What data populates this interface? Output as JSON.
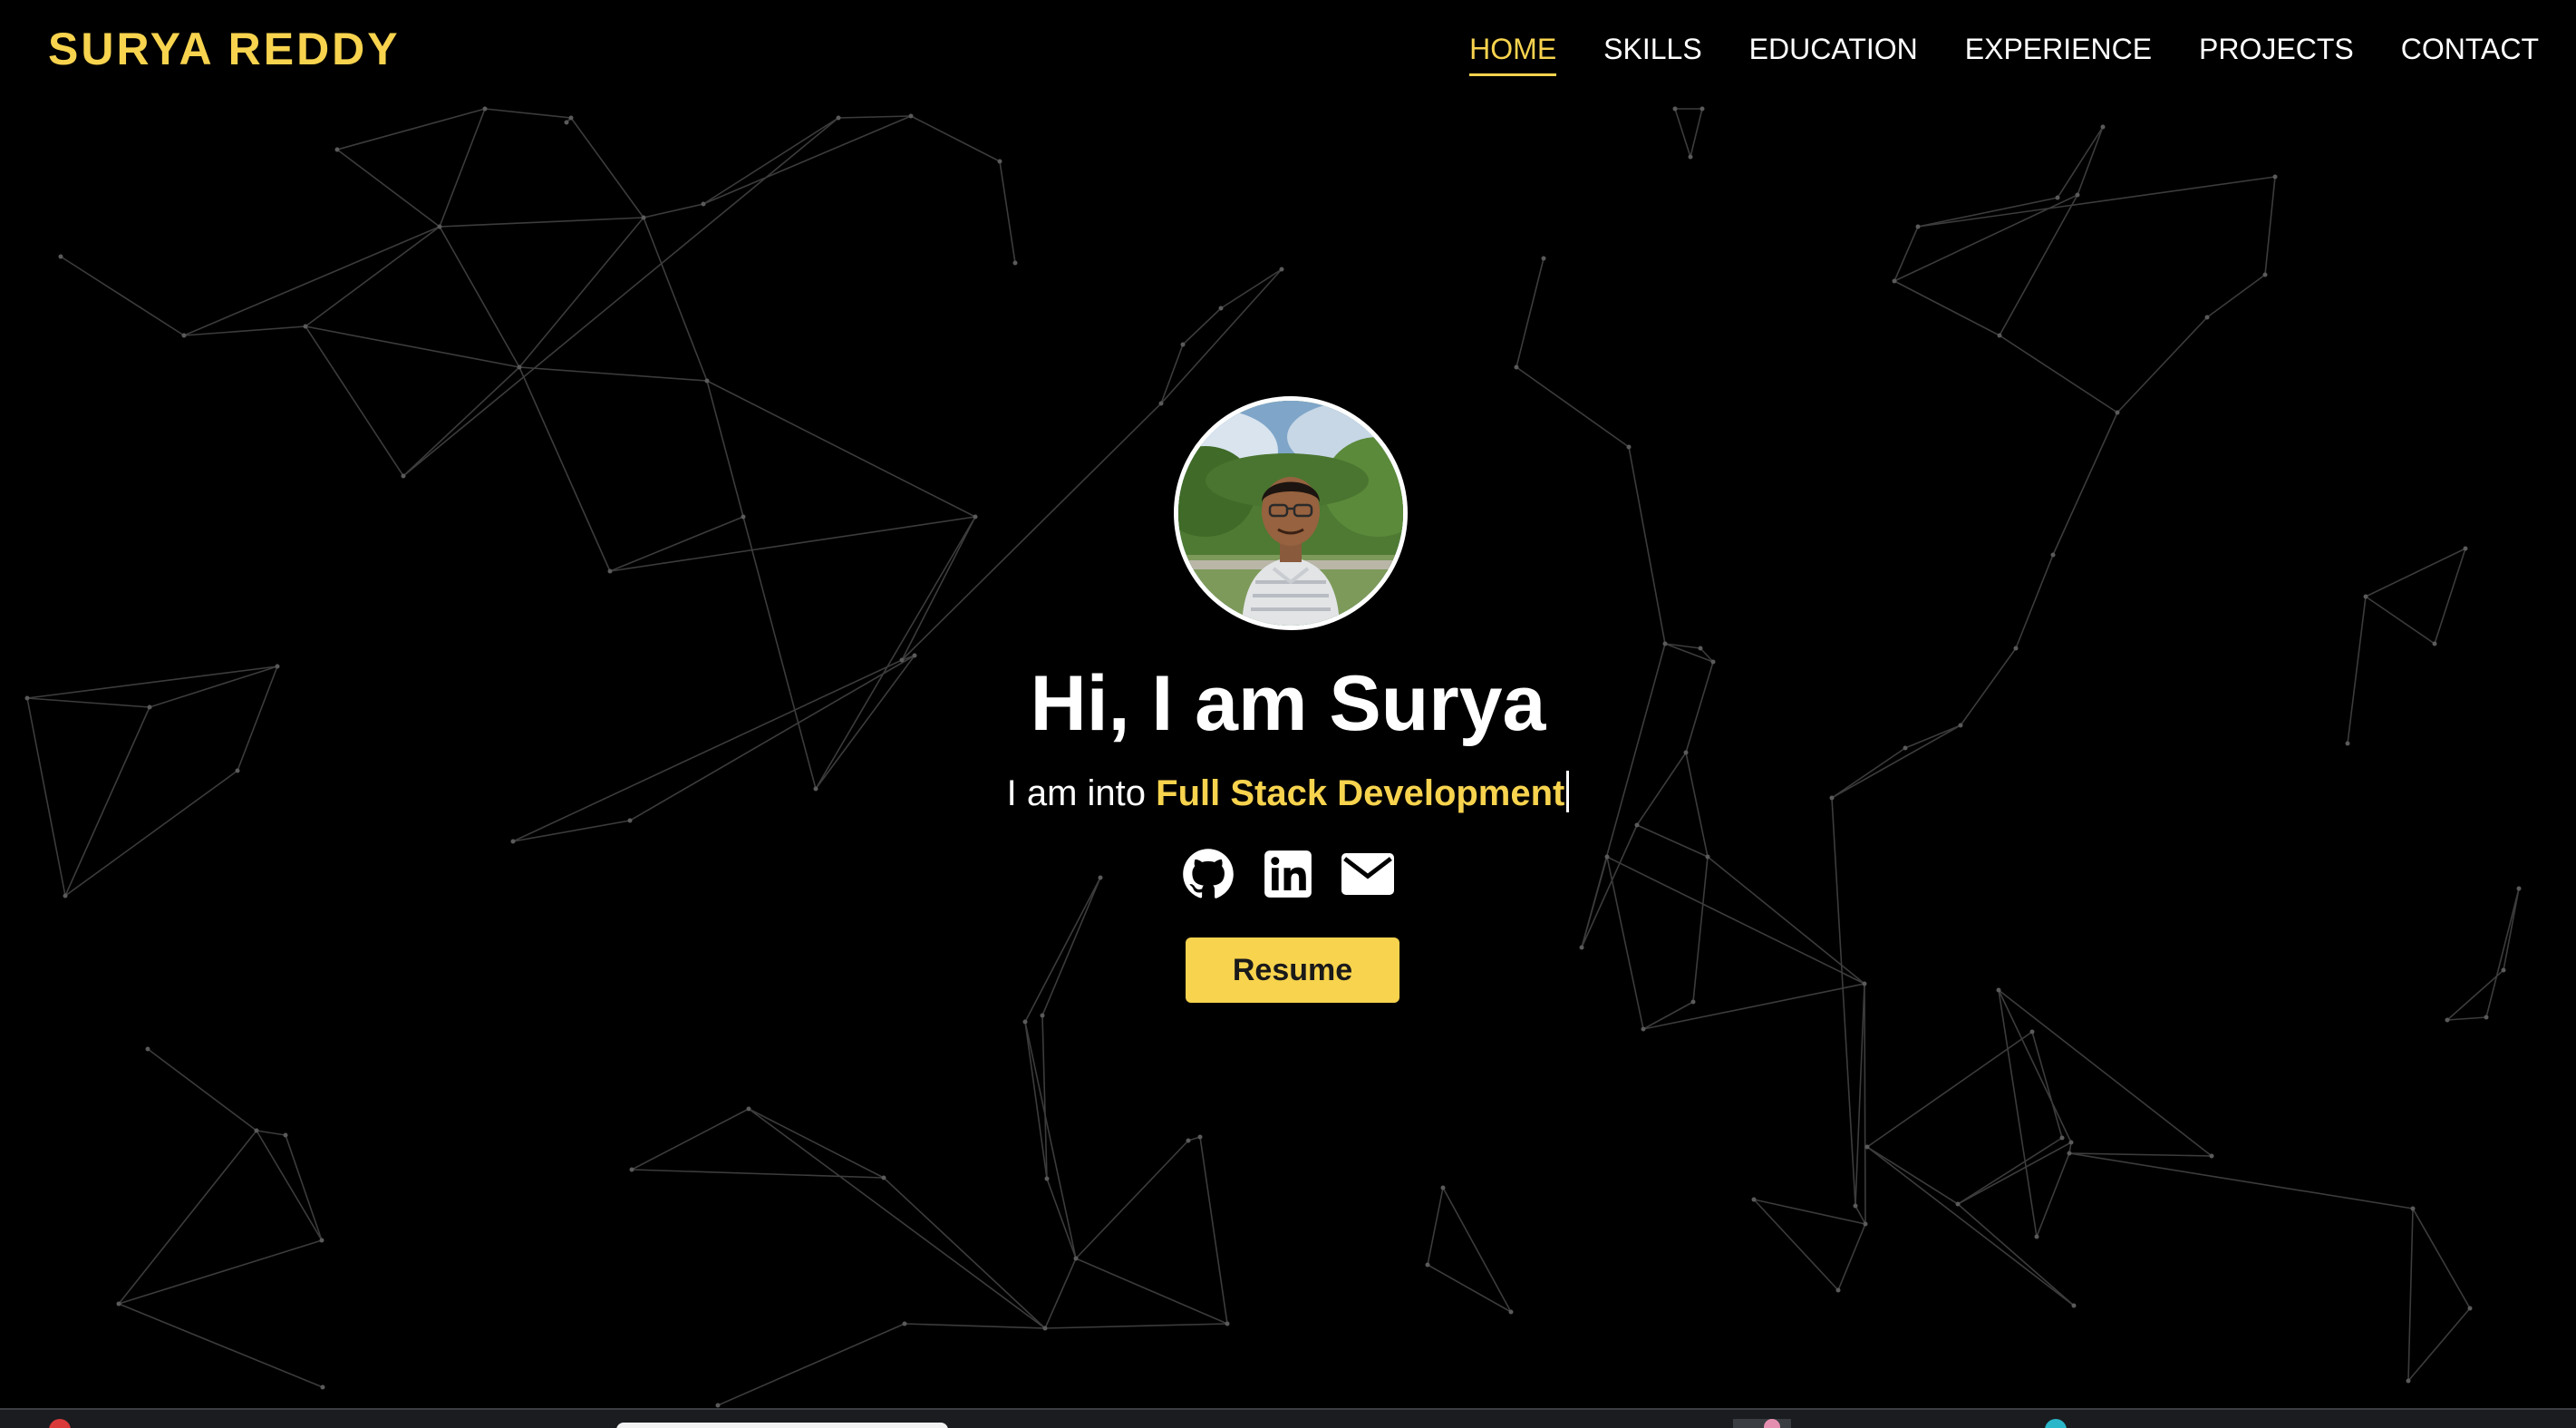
{
  "brand": "SURYA REDDY",
  "nav": {
    "items": [
      {
        "label": "HOME",
        "active": true
      },
      {
        "label": "SKILLS",
        "active": false
      },
      {
        "label": "EDUCATION",
        "active": false
      },
      {
        "label": "EXPERIENCE",
        "active": false
      },
      {
        "label": "PROJECTS",
        "active": false
      },
      {
        "label": "CONTACT",
        "active": false
      }
    ]
  },
  "hero": {
    "title": "Hi, I am Surya",
    "subtitle_prefix": "I am into",
    "subtitle_typed": "Full Stack Development",
    "resume_label": "Resume"
  },
  "socials": [
    {
      "name": "github-icon"
    },
    {
      "name": "linkedin-icon"
    },
    {
      "name": "email-icon"
    }
  ],
  "colors": {
    "background": "#000000",
    "accent": "#f7d34e",
    "text": "#ffffff",
    "network_lines": "#3c3c3c"
  }
}
